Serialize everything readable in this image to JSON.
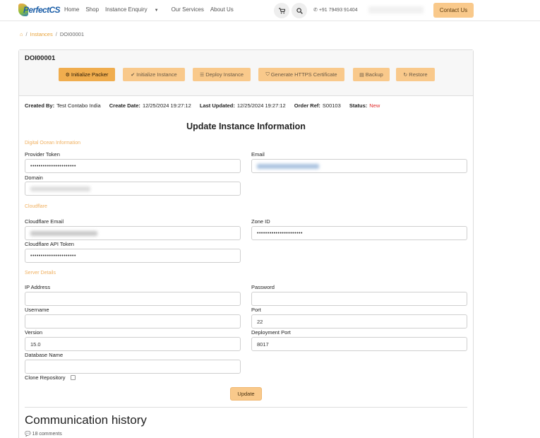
{
  "nav": {
    "logo_text": "PerfectCS",
    "links": [
      "Home",
      "Shop",
      "Instance Enquiry",
      "Our Services",
      "About Us"
    ],
    "cart_icon": "cart-icon",
    "search_icon": "search-icon",
    "phone": "+91 79493 91404",
    "contact_label": "Contact Us"
  },
  "breadcrumb": {
    "link": "Instances",
    "current": "DOI00001"
  },
  "card": {
    "title": "DOI00001",
    "actions": [
      {
        "label": "Initialize Packer",
        "icon": "gear-icon",
        "glyph": "⚙"
      },
      {
        "label": "Initialize Instance",
        "icon": "check-icon",
        "glyph": "✔"
      },
      {
        "label": "Deploy Instance",
        "icon": "list-icon",
        "glyph": "☰"
      },
      {
        "label": "Generate HTTPS Certificate",
        "icon": "shield-icon",
        "glyph": "⛉"
      },
      {
        "label": "Backup",
        "icon": "database-icon",
        "glyph": "▤"
      },
      {
        "label": "Restore",
        "icon": "refresh-icon",
        "glyph": "↻"
      }
    ],
    "meta": {
      "created_by_label": "Created By:",
      "created_by": "Test Contabo India",
      "create_date_label": "Create Date:",
      "create_date": "12/25/2024 19:27:12",
      "last_updated_label": "Last Updated:",
      "last_updated": "12/25/2024 19:27:12",
      "order_ref_label": "Order Ref:",
      "order_ref": "S00103",
      "status_label": "Status:",
      "status": "New"
    },
    "form_title": "Update Instance Information",
    "status_color": "#e02b2b"
  },
  "form": {
    "section_do": "Digital Ocean Information",
    "provider_token_label": "Provider Token",
    "provider_token_value": "••••••••••••••••••••••",
    "email_label": "Email",
    "domain_label": "Domain",
    "section_cf": "Cloudflare",
    "cf_email_label": "Cloudflare Email",
    "zone_id_label": "Zone ID",
    "zone_id_value": "••••••••••••••••••••••",
    "cf_token_label": "Cloudflare API Token",
    "cf_token_value": "••••••••••••••••••••••",
    "section_server": "Server Details",
    "ip_label": "IP Address",
    "password_label": "Password",
    "username_label": "Username",
    "port_label": "Port",
    "port_value": "22",
    "version_label": "Version",
    "version_value": "15.0",
    "deploy_port_label": "Deployment Port",
    "deploy_port_value": "8017",
    "db_name_label": "Database Name",
    "clone_label": "Clone Repository",
    "update_label": "Update"
  },
  "history": {
    "title": "Communication history",
    "comments": "18 comments",
    "comment_icon": "comment-icon"
  },
  "colors": {
    "accent": "#f9c98b",
    "accent_active": "#f0ad4e",
    "section": "#f0b060",
    "link": "#e8a33a"
  }
}
